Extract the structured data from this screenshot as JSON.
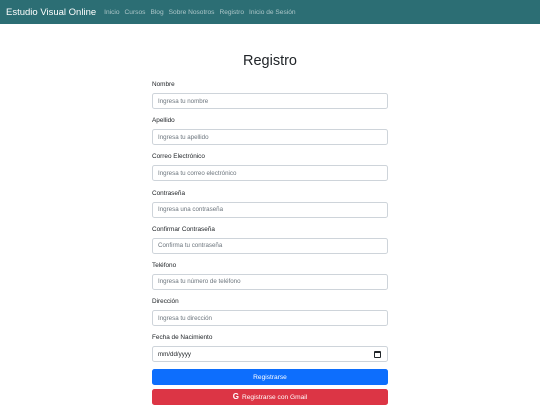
{
  "navbar": {
    "brand": "Estudio Visual Online",
    "links": [
      "Inicio",
      "Cursos",
      "Blog",
      "Sobre Nosotros",
      "Registro",
      "Inicio de Sesión"
    ]
  },
  "page": {
    "title": "Registro"
  },
  "form": {
    "fields": [
      {
        "label": "Nombre",
        "placeholder": "Ingresa tu nombre"
      },
      {
        "label": "Apellido",
        "placeholder": "Ingresa tu apellido"
      },
      {
        "label": "Correo Electrónico",
        "placeholder": "Ingresa tu correo electrónico"
      },
      {
        "label": "Contraseña",
        "placeholder": "Ingresa una contraseña"
      },
      {
        "label": "Confirmar Contraseña",
        "placeholder": "Confirma tu contraseña"
      },
      {
        "label": "Teléfono",
        "placeholder": "Ingresa tu número de teléfono"
      },
      {
        "label": "Dirección",
        "placeholder": "Ingresa tu dirección"
      },
      {
        "label": "Fecha de Nacimiento",
        "placeholder": "mm/dd/yyyy"
      }
    ],
    "submit_label": "Registrarse",
    "gmail_label": "Registrarse con Gmail"
  },
  "colors": {
    "navbar": "#2c6e74",
    "primary": "#0d6efd",
    "danger": "#dc3545"
  },
  "icons": {
    "gmail": "google-icon",
    "date": "calendar-icon"
  }
}
